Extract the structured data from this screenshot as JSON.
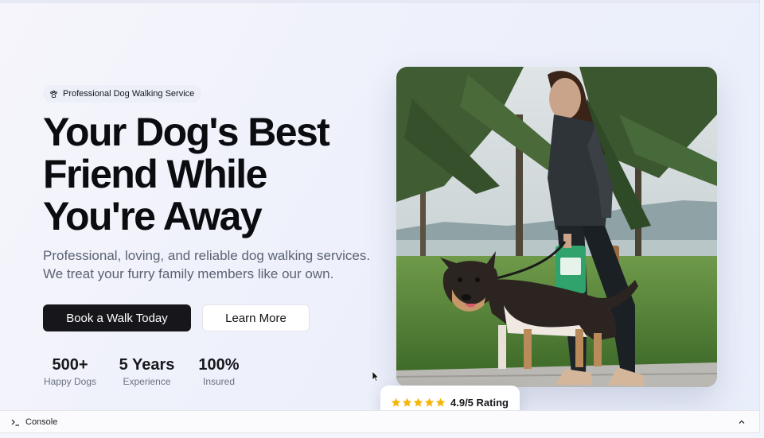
{
  "badge": {
    "icon": "paw-icon",
    "label": "Professional Dog Walking Service"
  },
  "hero": {
    "title_lines": [
      "Your Dog's Best",
      "Friend While",
      "You're Away"
    ],
    "subtitle_lines": [
      "Professional, loving, and reliable dog walking services.",
      "We treat your furry family members like our own."
    ]
  },
  "buttons": {
    "primary": "Book a Walk Today",
    "secondary": "Learn More"
  },
  "stats": [
    {
      "value": "500+",
      "label": "Happy Dogs"
    },
    {
      "value": "5 Years",
      "label": "Experience"
    },
    {
      "value": "100%",
      "label": "Insured"
    }
  ],
  "photo": {
    "subject": "woman walking a dog on a leash in a park with palm trees"
  },
  "rating": {
    "stars": 5,
    "text": "4.9/5 Rating",
    "star_color": "#f5b50a"
  },
  "console": {
    "label": "Console",
    "icon": "terminal-icon",
    "toggle_icon": "chevron-up-icon"
  }
}
